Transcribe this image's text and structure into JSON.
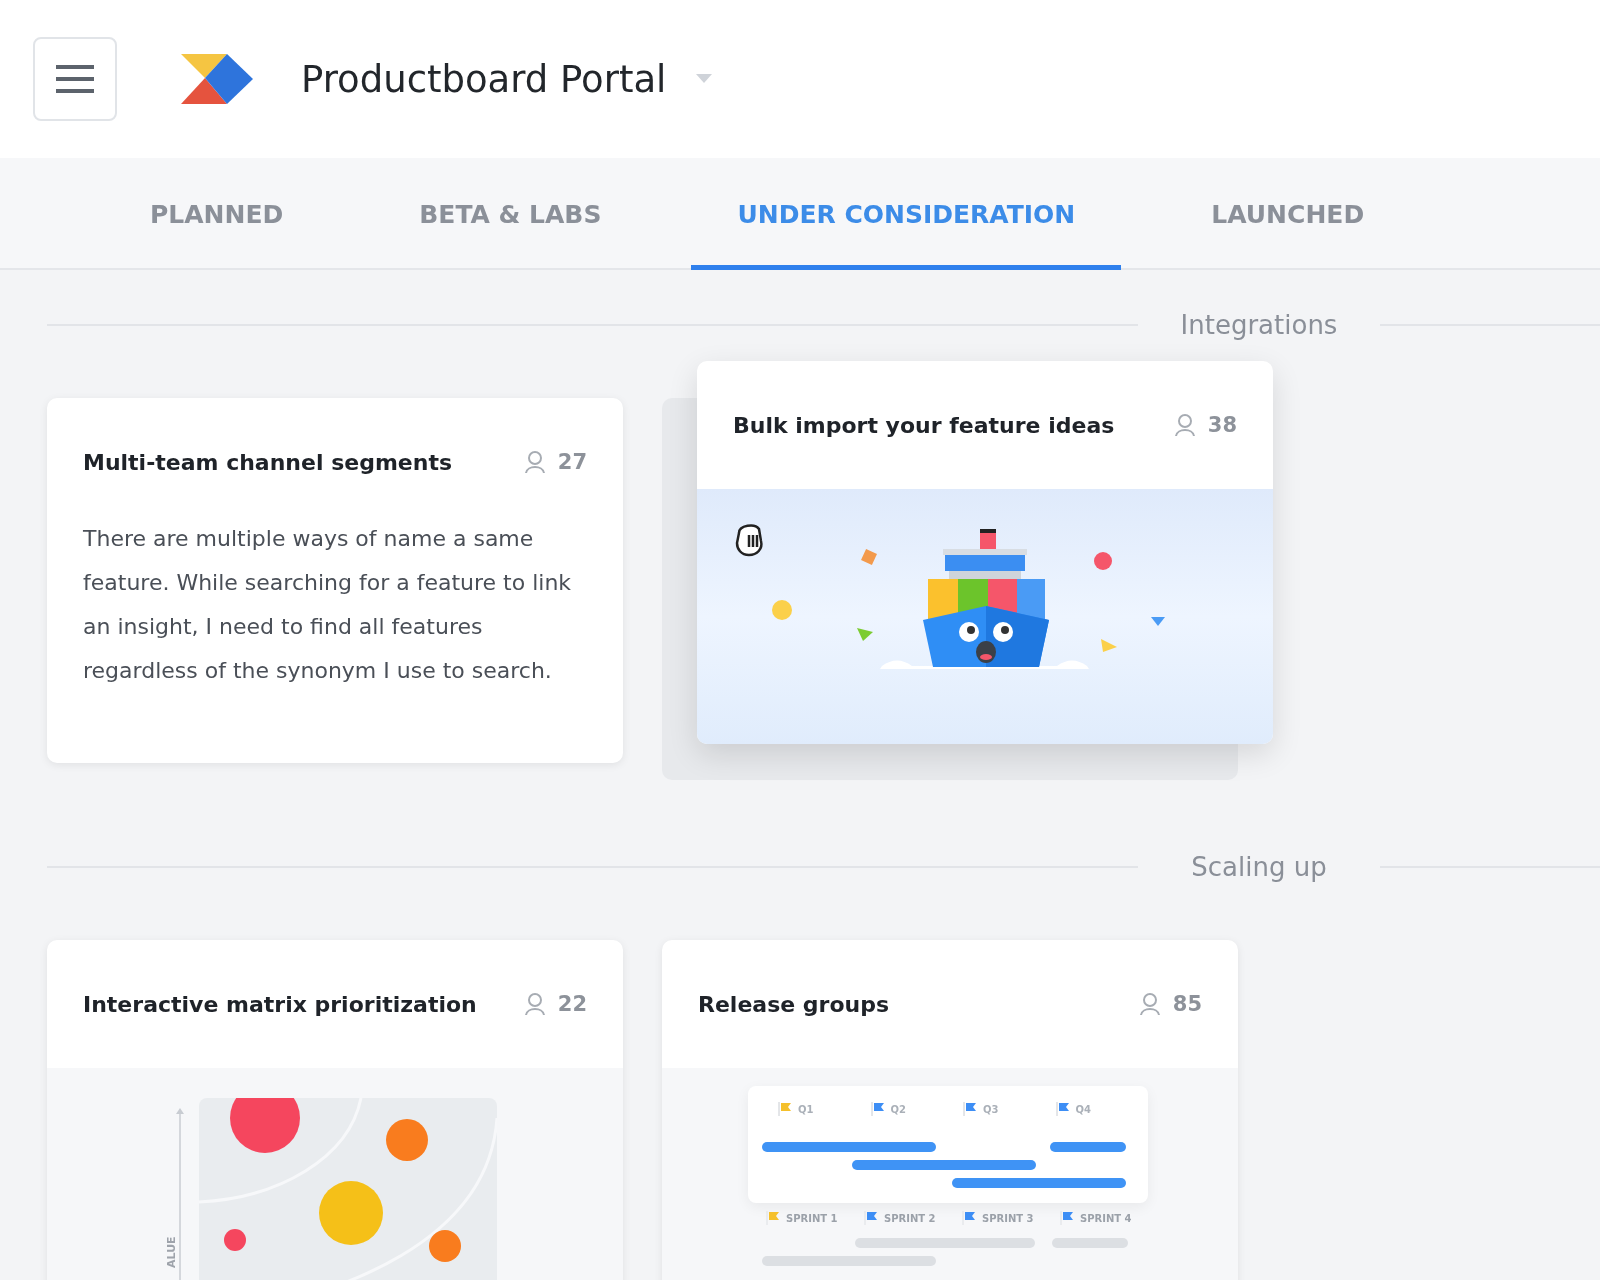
{
  "header": {
    "title": "Productboard Portal"
  },
  "tabs": [
    {
      "label": "PLANNED",
      "selected": false
    },
    {
      "label": "BETA & LABS",
      "selected": false
    },
    {
      "label": "UNDER CONSIDERATION",
      "selected": true
    },
    {
      "label": "LAUNCHED",
      "selected": false
    }
  ],
  "sections": [
    {
      "title": "Integrations",
      "cards": [
        {
          "kind": "text",
          "title": "Multi-team channel segments",
          "votes": "27",
          "lifted": false,
          "body": "There are multiple ways of name a same feature. While searching for a feature to link an insight, I need to find all features regardless of the synonym I use to search."
        },
        {
          "kind": "ship",
          "title": "Bulk import your feature ideas",
          "votes": "38",
          "lifted": true
        }
      ]
    },
    {
      "title": "Scaling up",
      "cards": [
        {
          "kind": "matrix",
          "title": "Interactive matrix prioritization",
          "votes": "22",
          "lifted": false,
          "axis_label": "ALUE"
        },
        {
          "kind": "release",
          "title": "Release groups",
          "votes": "85",
          "lifted": false,
          "quarters": [
            {
              "label": "Q1",
              "color": "#f5c02b"
            },
            {
              "label": "Q2",
              "color": "#3d8ef5"
            },
            {
              "label": "Q3",
              "color": "#3d8ef5"
            },
            {
              "label": "Q4",
              "color": "#3d8ef5"
            }
          ],
          "sprints": [
            {
              "label": "SPRINT 1",
              "color": "#f5c02b"
            },
            {
              "label": "SPRINT 2",
              "color": "#3d8ef5"
            },
            {
              "label": "SPRINT 3",
              "color": "#3d8ef5"
            },
            {
              "label": "SPRINT 4",
              "color": "#3d8ef5"
            }
          ]
        }
      ]
    }
  ]
}
